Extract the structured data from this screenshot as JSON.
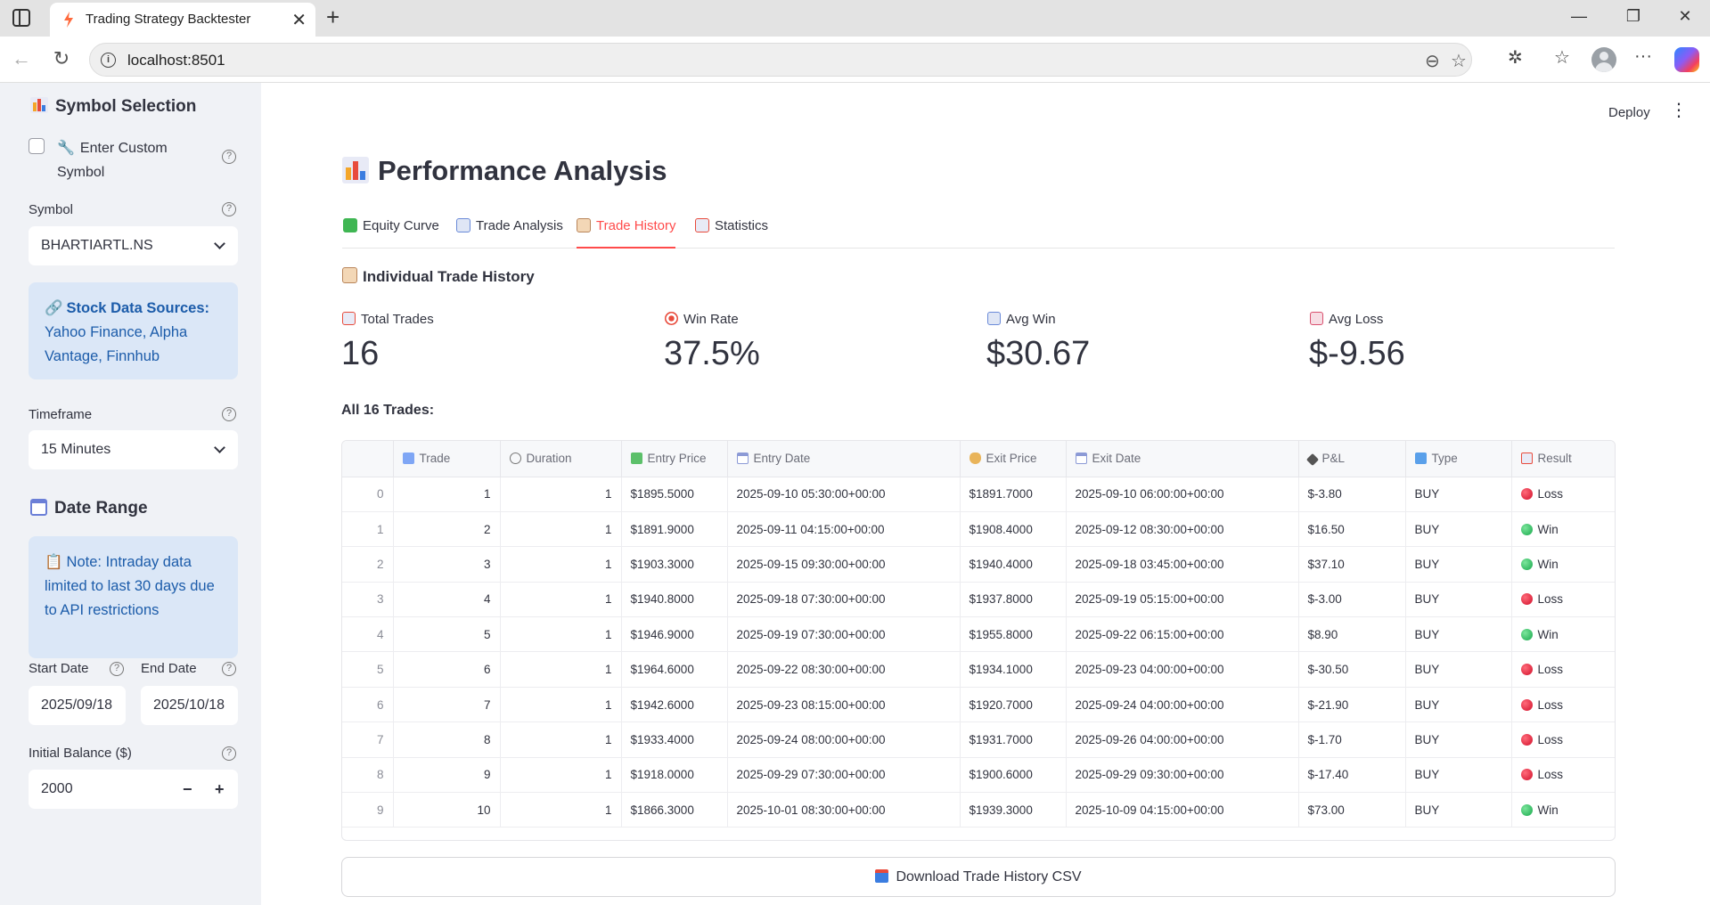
{
  "browser": {
    "tab_title": "Trading Strategy Backtester",
    "url": "localhost:8501"
  },
  "header": {
    "deploy_label": "Deploy"
  },
  "sidebar": {
    "symbol_heading": "Symbol Selection",
    "custom_symbol_line1": "Enter Custom",
    "custom_symbol_line2": "Symbol",
    "symbol_label": "Symbol",
    "symbol_value": "BHARTIARTL.NS",
    "sources_title": "Stock Data Sources:",
    "sources_text": "Yahoo Finance, Alpha Vantage, Finnhub",
    "timeframe_label": "Timeframe",
    "timeframe_value": "15 Minutes",
    "date_range_heading": "Date Range",
    "note_text": "Note: Intraday data limited to last 30 days due to API restrictions",
    "start_date_label": "Start Date",
    "start_date_value": "2025/09/18",
    "end_date_label": "End Date",
    "end_date_value": "2025/10/18",
    "initial_balance_label": "Initial Balance ($)",
    "initial_balance_value": "2000"
  },
  "main": {
    "title": "Performance Analysis",
    "tabs": [
      {
        "label": "Equity Curve"
      },
      {
        "label": "Trade Analysis"
      },
      {
        "label": "Trade History"
      },
      {
        "label": "Statistics"
      }
    ],
    "active_tab": "Trade History",
    "section_heading": "Individual Trade History",
    "metrics": [
      {
        "label": "Total Trades",
        "value": "16"
      },
      {
        "label": "Win Rate",
        "value": "37.5%"
      },
      {
        "label": "Avg Win",
        "value": "$30.67"
      },
      {
        "label": "Avg Loss",
        "value": "$-9.56"
      }
    ],
    "trades_label": "All 16 Trades:",
    "download_label": "Download Trade History CSV"
  },
  "table": {
    "columns": [
      "Trade",
      "Duration",
      "Entry Price",
      "Entry Date",
      "Exit Price",
      "Exit Date",
      "P&L",
      "Type",
      "Result"
    ],
    "rows": [
      [
        "0",
        "1",
        "1",
        "$1895.5000",
        "2025-09-10 05:30:00+00:00",
        "$1891.7000",
        "2025-09-10 06:00:00+00:00",
        "$-3.80",
        "BUY",
        "Loss"
      ],
      [
        "1",
        "2",
        "1",
        "$1891.9000",
        "2025-09-11 04:15:00+00:00",
        "$1908.4000",
        "2025-09-12 08:30:00+00:00",
        "$16.50",
        "BUY",
        "Win"
      ],
      [
        "2",
        "3",
        "1",
        "$1903.3000",
        "2025-09-15 09:30:00+00:00",
        "$1940.4000",
        "2025-09-18 03:45:00+00:00",
        "$37.10",
        "BUY",
        "Win"
      ],
      [
        "3",
        "4",
        "1",
        "$1940.8000",
        "2025-09-18 07:30:00+00:00",
        "$1937.8000",
        "2025-09-19 05:15:00+00:00",
        "$-3.00",
        "BUY",
        "Loss"
      ],
      [
        "4",
        "5",
        "1",
        "$1946.9000",
        "2025-09-19 07:30:00+00:00",
        "$1955.8000",
        "2025-09-22 06:15:00+00:00",
        "$8.90",
        "BUY",
        "Win"
      ],
      [
        "5",
        "6",
        "1",
        "$1964.6000",
        "2025-09-22 08:30:00+00:00",
        "$1934.1000",
        "2025-09-23 04:00:00+00:00",
        "$-30.50",
        "BUY",
        "Loss"
      ],
      [
        "6",
        "7",
        "1",
        "$1942.6000",
        "2025-09-23 08:15:00+00:00",
        "$1920.7000",
        "2025-09-24 04:00:00+00:00",
        "$-21.90",
        "BUY",
        "Loss"
      ],
      [
        "7",
        "8",
        "1",
        "$1933.4000",
        "2025-09-24 08:00:00+00:00",
        "$1931.7000",
        "2025-09-26 04:00:00+00:00",
        "$-1.70",
        "BUY",
        "Loss"
      ],
      [
        "8",
        "9",
        "1",
        "$1918.0000",
        "2025-09-29 07:30:00+00:00",
        "$1900.6000",
        "2025-09-29 09:30:00+00:00",
        "$-17.40",
        "BUY",
        "Loss"
      ],
      [
        "9",
        "10",
        "1",
        "$1866.3000",
        "2025-10-01 08:30:00+00:00",
        "$1939.3000",
        "2025-10-09 04:15:00+00:00",
        "$73.00",
        "BUY",
        "Win"
      ]
    ]
  }
}
